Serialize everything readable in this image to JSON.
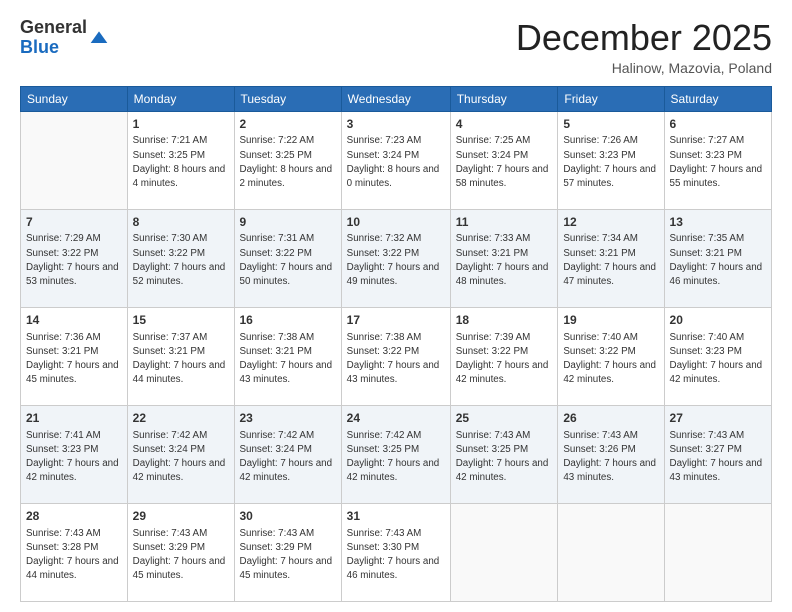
{
  "header": {
    "logo_general": "General",
    "logo_blue": "Blue",
    "month_title": "December 2025",
    "subtitle": "Halinow, Mazovia, Poland"
  },
  "days_of_week": [
    "Sunday",
    "Monday",
    "Tuesday",
    "Wednesday",
    "Thursday",
    "Friday",
    "Saturday"
  ],
  "weeks": [
    [
      {
        "num": "",
        "sunrise": "",
        "sunset": "",
        "daylight": ""
      },
      {
        "num": "1",
        "sunrise": "7:21 AM",
        "sunset": "3:25 PM",
        "daylight": "8 hours and 4 minutes."
      },
      {
        "num": "2",
        "sunrise": "7:22 AM",
        "sunset": "3:25 PM",
        "daylight": "8 hours and 2 minutes."
      },
      {
        "num": "3",
        "sunrise": "7:23 AM",
        "sunset": "3:24 PM",
        "daylight": "8 hours and 0 minutes."
      },
      {
        "num": "4",
        "sunrise": "7:25 AM",
        "sunset": "3:24 PM",
        "daylight": "7 hours and 58 minutes."
      },
      {
        "num": "5",
        "sunrise": "7:26 AM",
        "sunset": "3:23 PM",
        "daylight": "7 hours and 57 minutes."
      },
      {
        "num": "6",
        "sunrise": "7:27 AM",
        "sunset": "3:23 PM",
        "daylight": "7 hours and 55 minutes."
      }
    ],
    [
      {
        "num": "7",
        "sunrise": "7:29 AM",
        "sunset": "3:22 PM",
        "daylight": "7 hours and 53 minutes."
      },
      {
        "num": "8",
        "sunrise": "7:30 AM",
        "sunset": "3:22 PM",
        "daylight": "7 hours and 52 minutes."
      },
      {
        "num": "9",
        "sunrise": "7:31 AM",
        "sunset": "3:22 PM",
        "daylight": "7 hours and 50 minutes."
      },
      {
        "num": "10",
        "sunrise": "7:32 AM",
        "sunset": "3:22 PM",
        "daylight": "7 hours and 49 minutes."
      },
      {
        "num": "11",
        "sunrise": "7:33 AM",
        "sunset": "3:21 PM",
        "daylight": "7 hours and 48 minutes."
      },
      {
        "num": "12",
        "sunrise": "7:34 AM",
        "sunset": "3:21 PM",
        "daylight": "7 hours and 47 minutes."
      },
      {
        "num": "13",
        "sunrise": "7:35 AM",
        "sunset": "3:21 PM",
        "daylight": "7 hours and 46 minutes."
      }
    ],
    [
      {
        "num": "14",
        "sunrise": "7:36 AM",
        "sunset": "3:21 PM",
        "daylight": "7 hours and 45 minutes."
      },
      {
        "num": "15",
        "sunrise": "7:37 AM",
        "sunset": "3:21 PM",
        "daylight": "7 hours and 44 minutes."
      },
      {
        "num": "16",
        "sunrise": "7:38 AM",
        "sunset": "3:21 PM",
        "daylight": "7 hours and 43 minutes."
      },
      {
        "num": "17",
        "sunrise": "7:38 AM",
        "sunset": "3:22 PM",
        "daylight": "7 hours and 43 minutes."
      },
      {
        "num": "18",
        "sunrise": "7:39 AM",
        "sunset": "3:22 PM",
        "daylight": "7 hours and 42 minutes."
      },
      {
        "num": "19",
        "sunrise": "7:40 AM",
        "sunset": "3:22 PM",
        "daylight": "7 hours and 42 minutes."
      },
      {
        "num": "20",
        "sunrise": "7:40 AM",
        "sunset": "3:23 PM",
        "daylight": "7 hours and 42 minutes."
      }
    ],
    [
      {
        "num": "21",
        "sunrise": "7:41 AM",
        "sunset": "3:23 PM",
        "daylight": "7 hours and 42 minutes."
      },
      {
        "num": "22",
        "sunrise": "7:42 AM",
        "sunset": "3:24 PM",
        "daylight": "7 hours and 42 minutes."
      },
      {
        "num": "23",
        "sunrise": "7:42 AM",
        "sunset": "3:24 PM",
        "daylight": "7 hours and 42 minutes."
      },
      {
        "num": "24",
        "sunrise": "7:42 AM",
        "sunset": "3:25 PM",
        "daylight": "7 hours and 42 minutes."
      },
      {
        "num": "25",
        "sunrise": "7:43 AM",
        "sunset": "3:25 PM",
        "daylight": "7 hours and 42 minutes."
      },
      {
        "num": "26",
        "sunrise": "7:43 AM",
        "sunset": "3:26 PM",
        "daylight": "7 hours and 43 minutes."
      },
      {
        "num": "27",
        "sunrise": "7:43 AM",
        "sunset": "3:27 PM",
        "daylight": "7 hours and 43 minutes."
      }
    ],
    [
      {
        "num": "28",
        "sunrise": "7:43 AM",
        "sunset": "3:28 PM",
        "daylight": "7 hours and 44 minutes."
      },
      {
        "num": "29",
        "sunrise": "7:43 AM",
        "sunset": "3:29 PM",
        "daylight": "7 hours and 45 minutes."
      },
      {
        "num": "30",
        "sunrise": "7:43 AM",
        "sunset": "3:29 PM",
        "daylight": "7 hours and 45 minutes."
      },
      {
        "num": "31",
        "sunrise": "7:43 AM",
        "sunset": "3:30 PM",
        "daylight": "7 hours and 46 minutes."
      },
      {
        "num": "",
        "sunrise": "",
        "sunset": "",
        "daylight": ""
      },
      {
        "num": "",
        "sunrise": "",
        "sunset": "",
        "daylight": ""
      },
      {
        "num": "",
        "sunrise": "",
        "sunset": "",
        "daylight": ""
      }
    ]
  ]
}
